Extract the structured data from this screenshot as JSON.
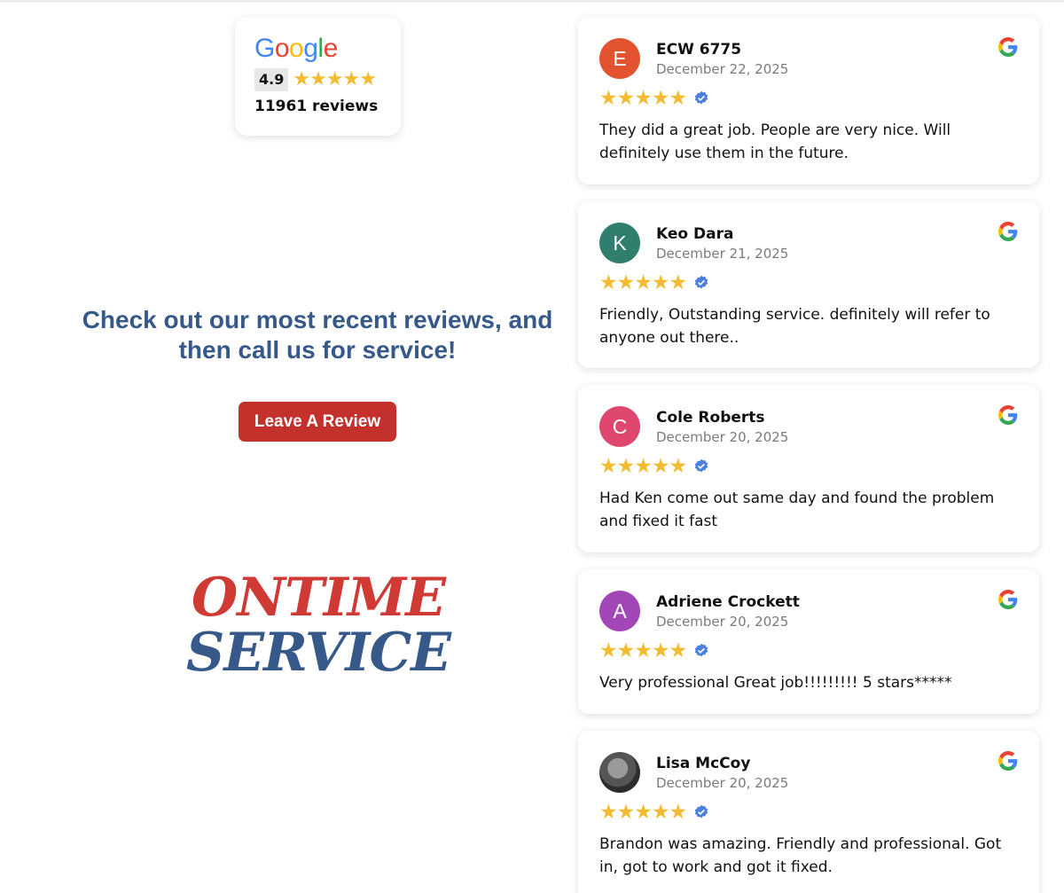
{
  "summary": {
    "brand": "Google",
    "rating": "4.9",
    "stars": "★★★★★",
    "reviews_count": "11961 reviews"
  },
  "headline": "Check out our most recent reviews, and then call us for service!",
  "leave_review_label": "Leave A Review",
  "logo": {
    "line1": "ONTIME",
    "line2": "SERVICE"
  },
  "colors": {
    "headline": "#36598a",
    "button": "#c4312d",
    "star": "#f2bb31",
    "verified": "#4a7fe0"
  },
  "reviews": [
    {
      "initial": "E",
      "avatar_color": "#e4532f",
      "name": "ECW 6775",
      "date": "December 22, 2025",
      "stars": "★★★★★",
      "text": "They did a great job. People are very nice. Will definitely use them in the future."
    },
    {
      "initial": "K",
      "avatar_color": "#2f7e6e",
      "name": "Keo Dara",
      "date": "December 21, 2025",
      "stars": "★★★★★",
      "text": "Friendly, Outstanding service. definitely will refer to anyone out there.."
    },
    {
      "initial": "C",
      "avatar_color": "#e0476e",
      "name": "Cole Roberts",
      "date": "December 20, 2025",
      "stars": "★★★★★",
      "text": "Had Ken come out same day and found the problem and fixed it fast"
    },
    {
      "initial": "A",
      "avatar_color": "#a347b8",
      "name": "Adriene Crockett",
      "date": "December 20, 2025",
      "stars": "★★★★★",
      "text": "Very professional Great job!!!!!!!!! 5 stars*****"
    },
    {
      "initial": "",
      "avatar_color": "",
      "name": "Lisa McCoy",
      "date": "December 20, 2025",
      "stars": "★★★★★",
      "text": "Brandon was amazing. Friendly and professional. Got in, got to work and got it fixed."
    }
  ]
}
